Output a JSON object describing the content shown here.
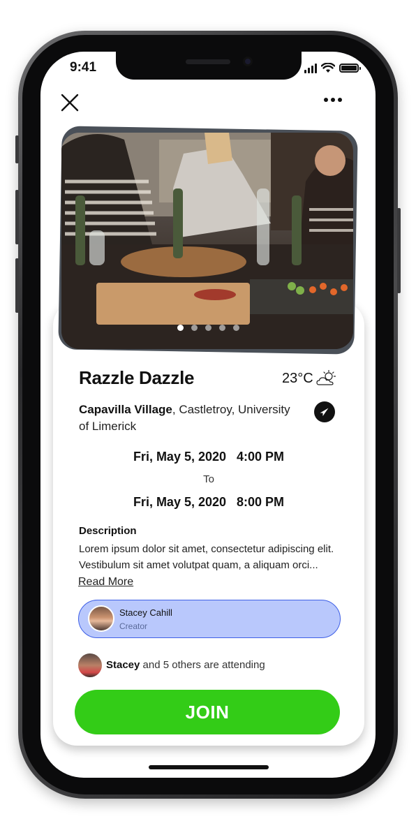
{
  "status_bar": {
    "time": "9:41"
  },
  "event": {
    "title": "Razzle Dazzle",
    "temperature": "23°C",
    "weather_icon": "partly-cloudy-icon",
    "location_primary": "Capavilla Village",
    "location_secondary": ", Castletroy, University of Limerick",
    "start": "Fri, May 5, 2020   4:00 PM",
    "to_label": "To",
    "end": "Fri, May 5, 2020   8:00 PM"
  },
  "carousel": {
    "total": 5,
    "active_index": 0
  },
  "description": {
    "heading": "Description",
    "text": "Lorem ipsum dolor sit amet, consectetur adipiscing elit. Vestibulum sit amet volutpat quam, a aliquam orci...",
    "read_more": "Read More"
  },
  "creator": {
    "name": "Stacey Cahill",
    "role": "Creator"
  },
  "attendance": {
    "first_name": "Stacey",
    "rest": " and 5 others are attending"
  },
  "join_label": "JOIN",
  "colors": {
    "join": "#33cc17",
    "creator_bg": "#b9c8fc",
    "creator_border": "#3e5fe6"
  }
}
